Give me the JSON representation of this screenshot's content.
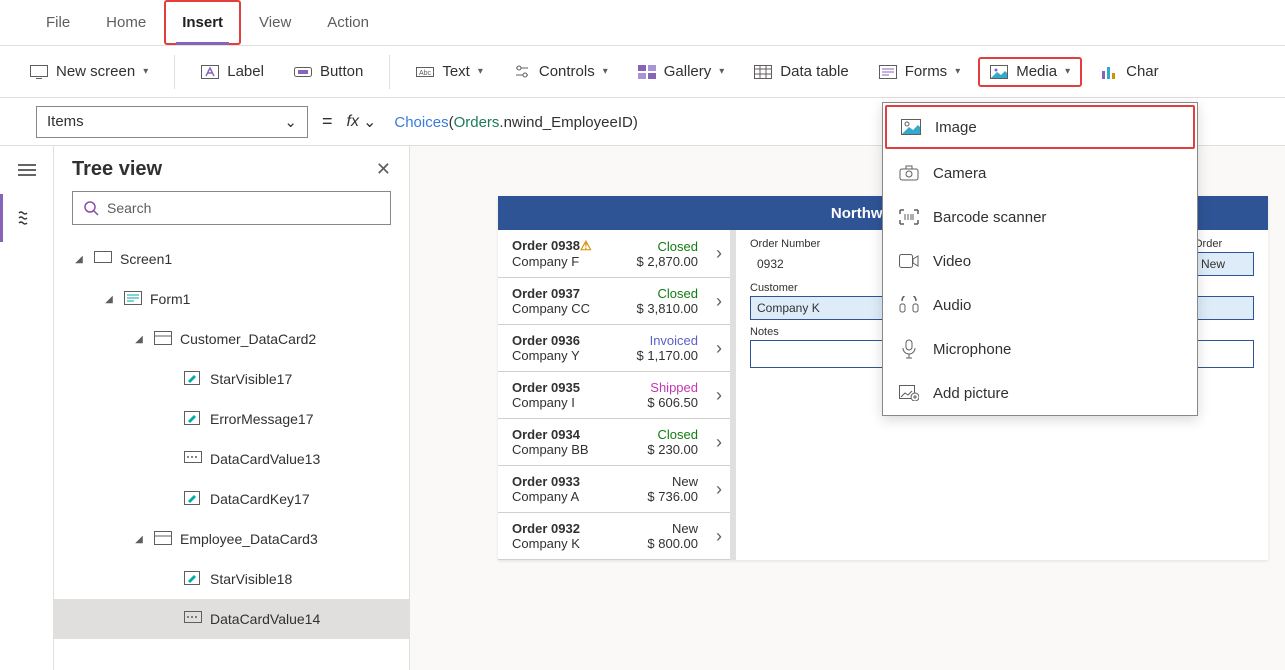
{
  "menubar": {
    "items": [
      "File",
      "Home",
      "Insert",
      "View",
      "Action"
    ],
    "active_index": 2
  },
  "ribbon": {
    "new_screen": "New screen",
    "label": "Label",
    "button": "Button",
    "text": "Text",
    "controls": "Controls",
    "gallery": "Gallery",
    "data_table": "Data table",
    "forms": "Forms",
    "media": "Media",
    "charts": "Char"
  },
  "formula": {
    "property": "Items",
    "expression_fn": "Choices",
    "expression_obj": "Orders",
    "expression_field": "nwind_EmployeeID"
  },
  "tree": {
    "title": "Tree view",
    "search_placeholder": "Search",
    "nodes": [
      {
        "label": "Screen1",
        "depth": 0,
        "icon": "screen",
        "expanded": true
      },
      {
        "label": "Form1",
        "depth": 1,
        "icon": "form",
        "expanded": true
      },
      {
        "label": "Customer_DataCard2",
        "depth": 2,
        "icon": "card",
        "expanded": true
      },
      {
        "label": "StarVisible17",
        "depth": 3,
        "icon": "edit"
      },
      {
        "label": "ErrorMessage17",
        "depth": 3,
        "icon": "edit"
      },
      {
        "label": "DataCardValue13",
        "depth": 3,
        "icon": "input"
      },
      {
        "label": "DataCardKey17",
        "depth": 3,
        "icon": "edit"
      },
      {
        "label": "Employee_DataCard3",
        "depth": 2,
        "icon": "card",
        "expanded": true
      },
      {
        "label": "StarVisible18",
        "depth": 3,
        "icon": "edit"
      },
      {
        "label": "DataCardValue14",
        "depth": 3,
        "icon": "input",
        "selected": true
      }
    ]
  },
  "preview": {
    "title": "Northwind Orc",
    "orders": [
      {
        "id": "Order 0938",
        "warn": true,
        "company": "Company F",
        "status": "Closed",
        "status_cls": "closed",
        "amount": "$ 2,870.00"
      },
      {
        "id": "Order 0937",
        "company": "Company CC",
        "status": "Closed",
        "status_cls": "closed",
        "amount": "$ 3,810.00"
      },
      {
        "id": "Order 0936",
        "company": "Company Y",
        "status": "Invoiced",
        "status_cls": "invoiced",
        "amount": "$ 1,170.00"
      },
      {
        "id": "Order 0935",
        "company": "Company I",
        "status": "Shipped",
        "status_cls": "shipped",
        "amount": "$ 606.50"
      },
      {
        "id": "Order 0934",
        "company": "Company BB",
        "status": "Closed",
        "status_cls": "closed",
        "amount": "$ 230.00"
      },
      {
        "id": "Order 0933",
        "company": "Company A",
        "status": "New",
        "status_cls": "new",
        "amount": "$ 736.00"
      },
      {
        "id": "Order 0932",
        "company": "Company K",
        "status": "New",
        "status_cls": "new",
        "amount": "$ 800.00"
      }
    ],
    "form": {
      "order_number_label": "Order Number",
      "order_number_value": "0932",
      "order_status_label": "Order",
      "order_status_value": "New",
      "customer_label": "Customer",
      "customer_value": "Company K",
      "notes_label": "Notes"
    }
  },
  "media_menu": {
    "items": [
      {
        "icon": "image",
        "label": "Image"
      },
      {
        "icon": "camera",
        "label": "Camera"
      },
      {
        "icon": "barcode",
        "label": "Barcode scanner"
      },
      {
        "icon": "video",
        "label": "Video"
      },
      {
        "icon": "audio",
        "label": "Audio"
      },
      {
        "icon": "mic",
        "label": "Microphone"
      },
      {
        "icon": "addpic",
        "label": "Add picture"
      }
    ]
  }
}
